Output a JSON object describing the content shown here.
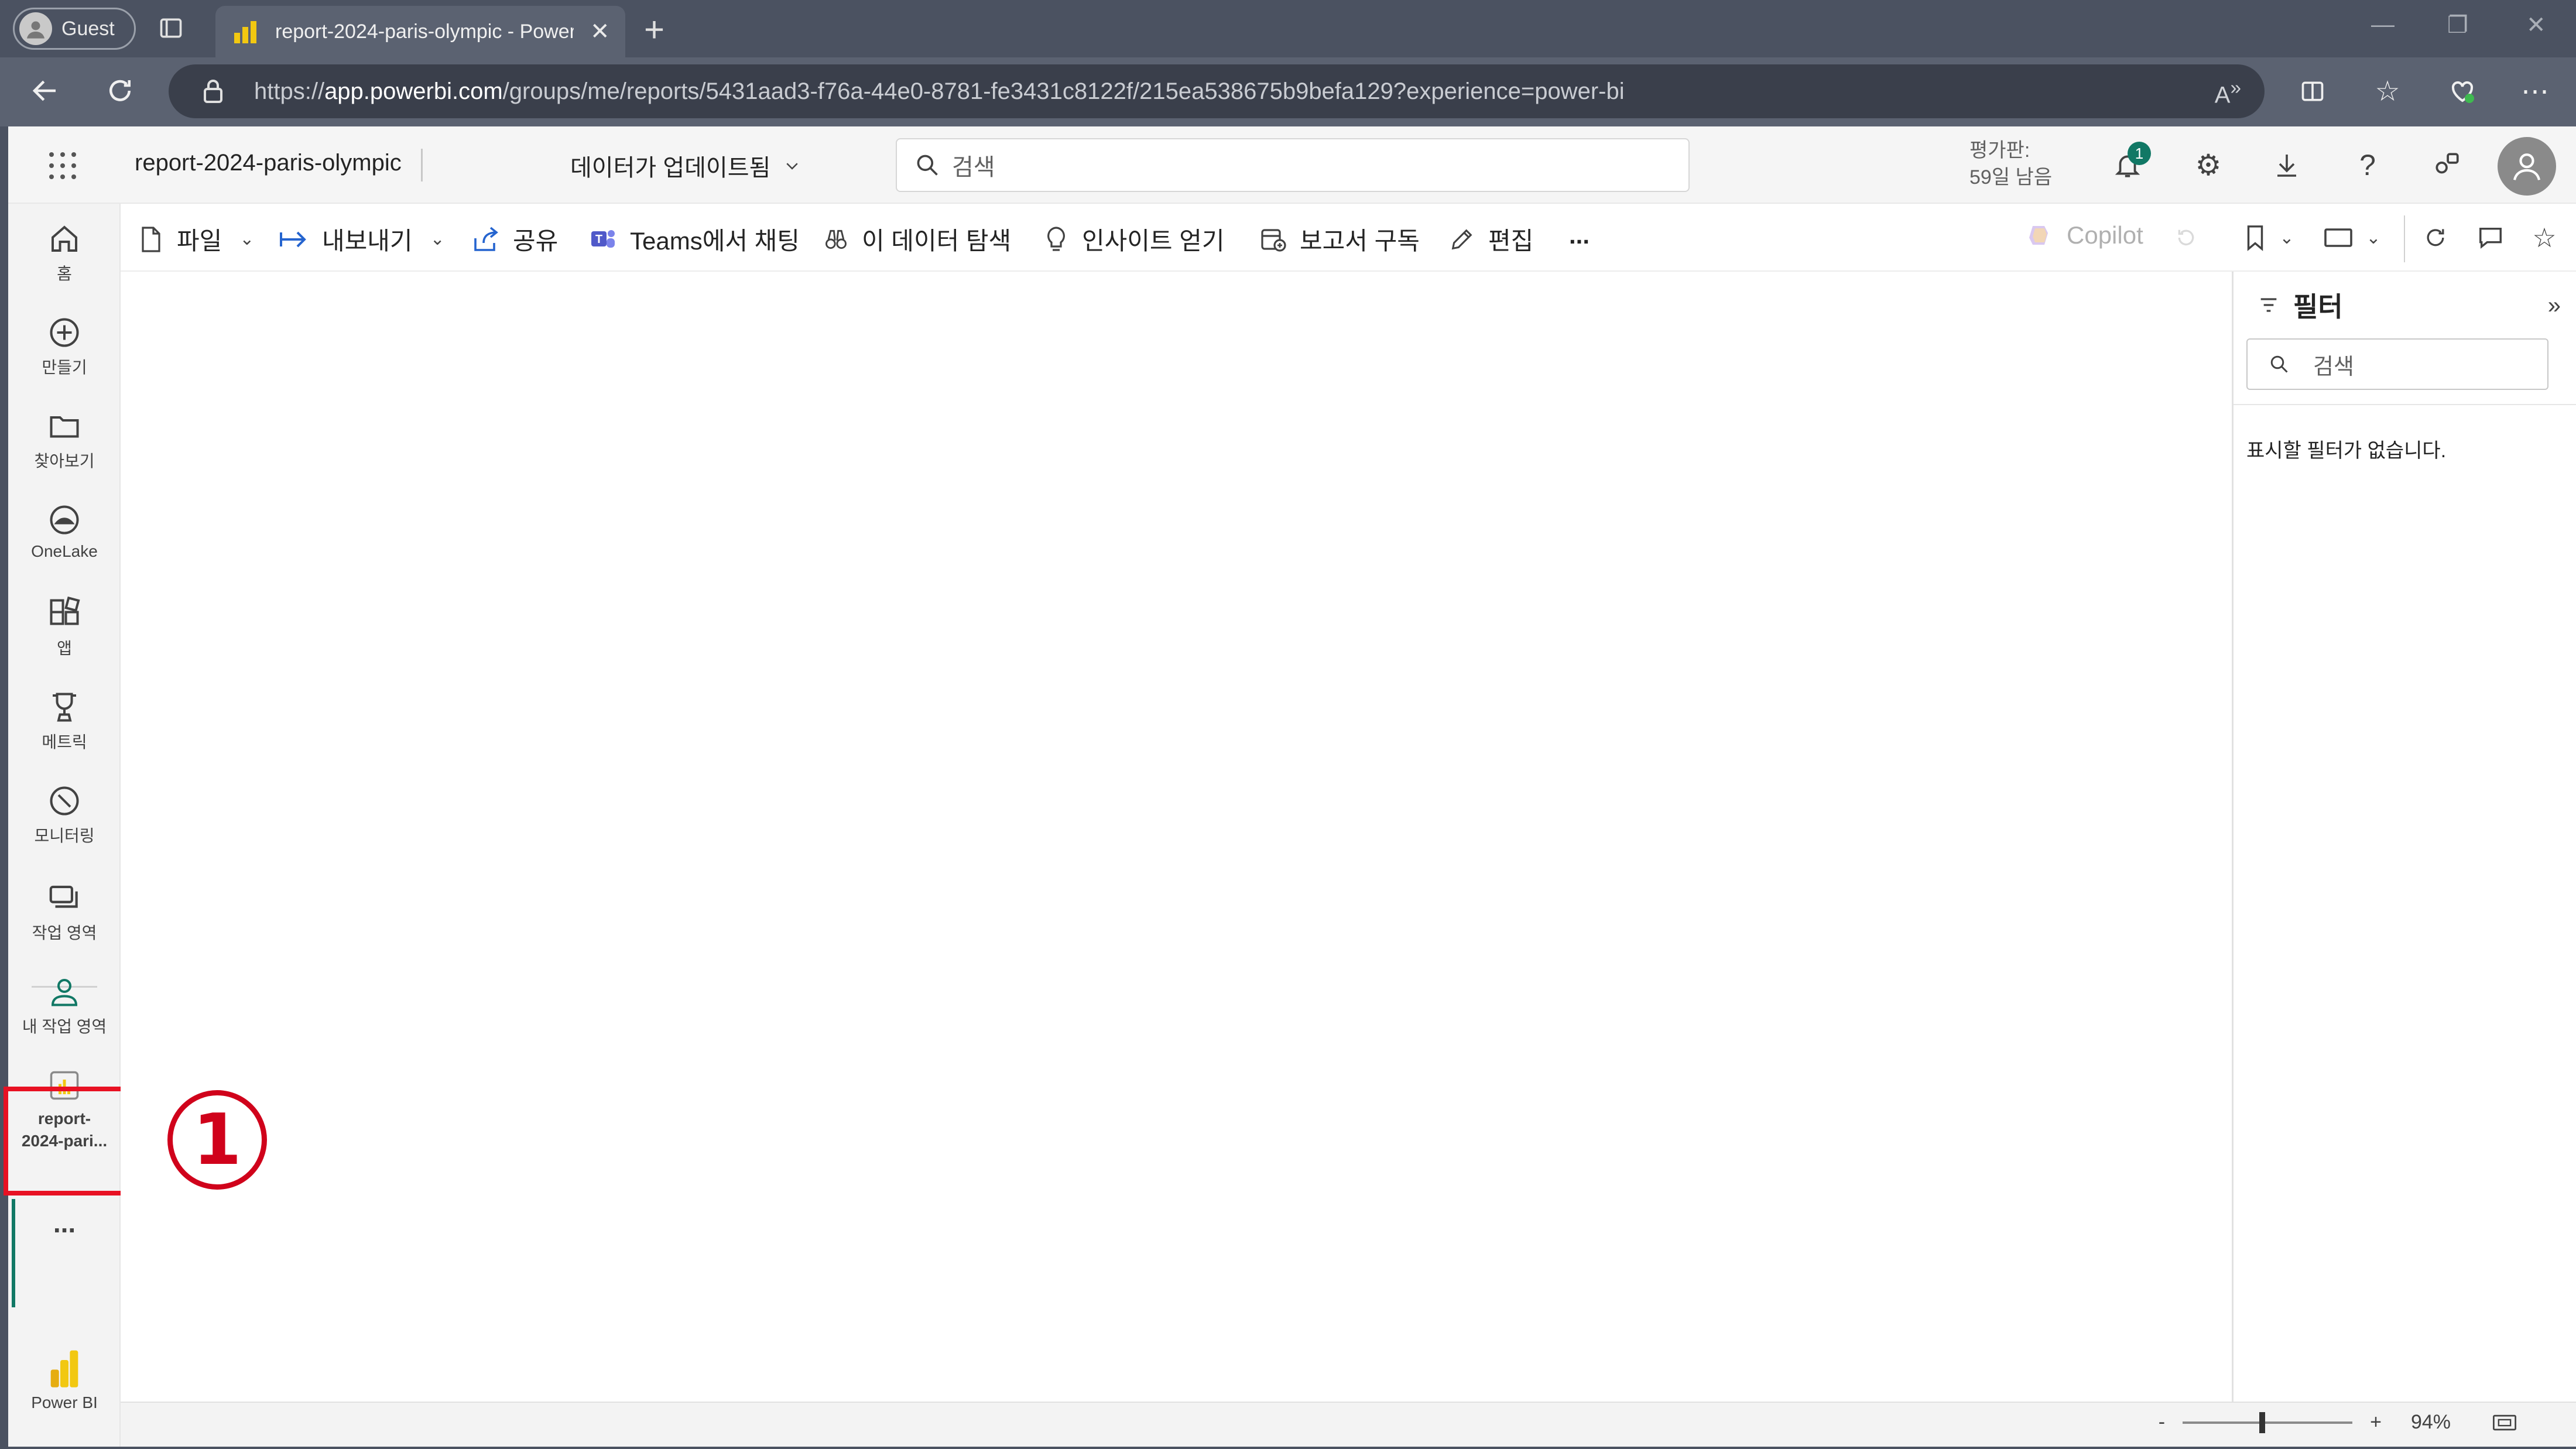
{
  "browser": {
    "profile_label": "Guest",
    "tab_title": "report-2024-paris-olympic - Power BI",
    "url_prefix": "https://",
    "url_host": "app.powerbi.com",
    "url_path": "/groups/me/reports/5431aad3-f76a-44e0-8781-fe3431c8122f/215ea538675b9befa129?experience=power-bi"
  },
  "header": {
    "report_title": "report-2024-paris-olympic",
    "data_status": "데이터가 업데이트됨",
    "search_placeholder": "검색",
    "trial_line1": "평가판:",
    "trial_line2": "59일 남음",
    "notification_count": "1"
  },
  "leftnav": {
    "items": [
      {
        "label": "홈",
        "icon": "home-icon"
      },
      {
        "label": "만들기",
        "icon": "create-icon"
      },
      {
        "label": "찾아보기",
        "icon": "browse-icon"
      },
      {
        "label": "OneLake",
        "icon": "onelake-icon"
      },
      {
        "label": "앱",
        "icon": "apps-icon"
      },
      {
        "label": "메트릭",
        "icon": "metrics-icon"
      },
      {
        "label": "모니터링",
        "icon": "monitor-icon"
      },
      {
        "label": "작업 영역",
        "icon": "workspaces-icon"
      },
      {
        "label": "내 작업 영역",
        "icon": "my-workspace-icon"
      },
      {
        "label": "report-2024-pari...",
        "label_line1": "report-",
        "label_line2": "2024-pari...",
        "icon": "report-icon"
      }
    ],
    "more": "...",
    "brand": "Power BI"
  },
  "commands": {
    "file": "파일",
    "export": "내보내기",
    "share": "공유",
    "teams": "Teams에서 채팅",
    "explore": "이 데이터 탐색",
    "insights": "인사이트 얻기",
    "subscribe": "보고서 구독",
    "edit": "편집",
    "more": "...",
    "copilot": "Copilot"
  },
  "filter_pane": {
    "title": "필터",
    "search_placeholder": "검색",
    "empty_text": "표시할 필터가 없습니다."
  },
  "statusbar": {
    "zoom_minus": "-",
    "zoom_plus": "+",
    "zoom_level": "94%",
    "zoom_fraction": 0.47
  },
  "annotation": {
    "step_label": "1"
  },
  "colors": {
    "accent": "#117865",
    "highlight": "#e81123",
    "powerbi_yellow": "#f2c811"
  }
}
